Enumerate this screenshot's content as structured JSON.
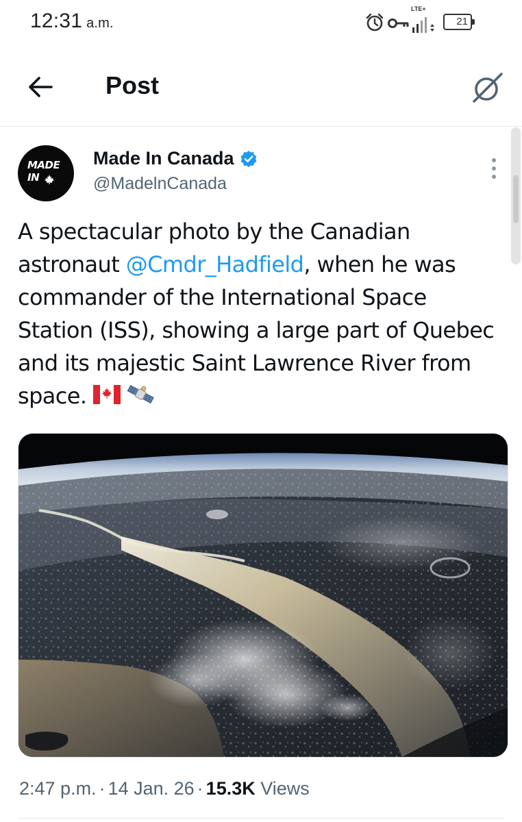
{
  "status_bar": {
    "time": "12:31",
    "ampm": "a.m.",
    "network_label": "LTE+",
    "battery_level": "21",
    "icons": [
      "alarm-icon",
      "vpn-key-icon",
      "signal-icon",
      "battery-icon"
    ]
  },
  "header": {
    "title": "Post",
    "back_icon": "arrow-left-icon",
    "grok_icon": "grok-icon"
  },
  "post": {
    "author": {
      "name": "Made In Canada",
      "handle": "@MadelnCanada",
      "verified": true,
      "avatar_text_line1": "MADE",
      "avatar_text_line2": "IN"
    },
    "text_part1": "A spectacular photo by the Canadian astronaut ",
    "mention": "@Cmdr_Hadfield",
    "text_part2": ", when he was commander of the International Space Station (ISS), showing a large part of Quebec and its majestic Saint Lawrence River from space.",
    "emojis": [
      "canada-flag",
      "satellite"
    ],
    "meta": {
      "time": "2:47 p.m.",
      "separator": "·",
      "date": "14 Jan. 26",
      "views_count": "15.3K",
      "views_label": "Views"
    }
  },
  "colors": {
    "accent": "#1d9bf0",
    "text_primary": "#0f1419",
    "text_secondary": "#536471",
    "divider": "#e6ecf0"
  }
}
